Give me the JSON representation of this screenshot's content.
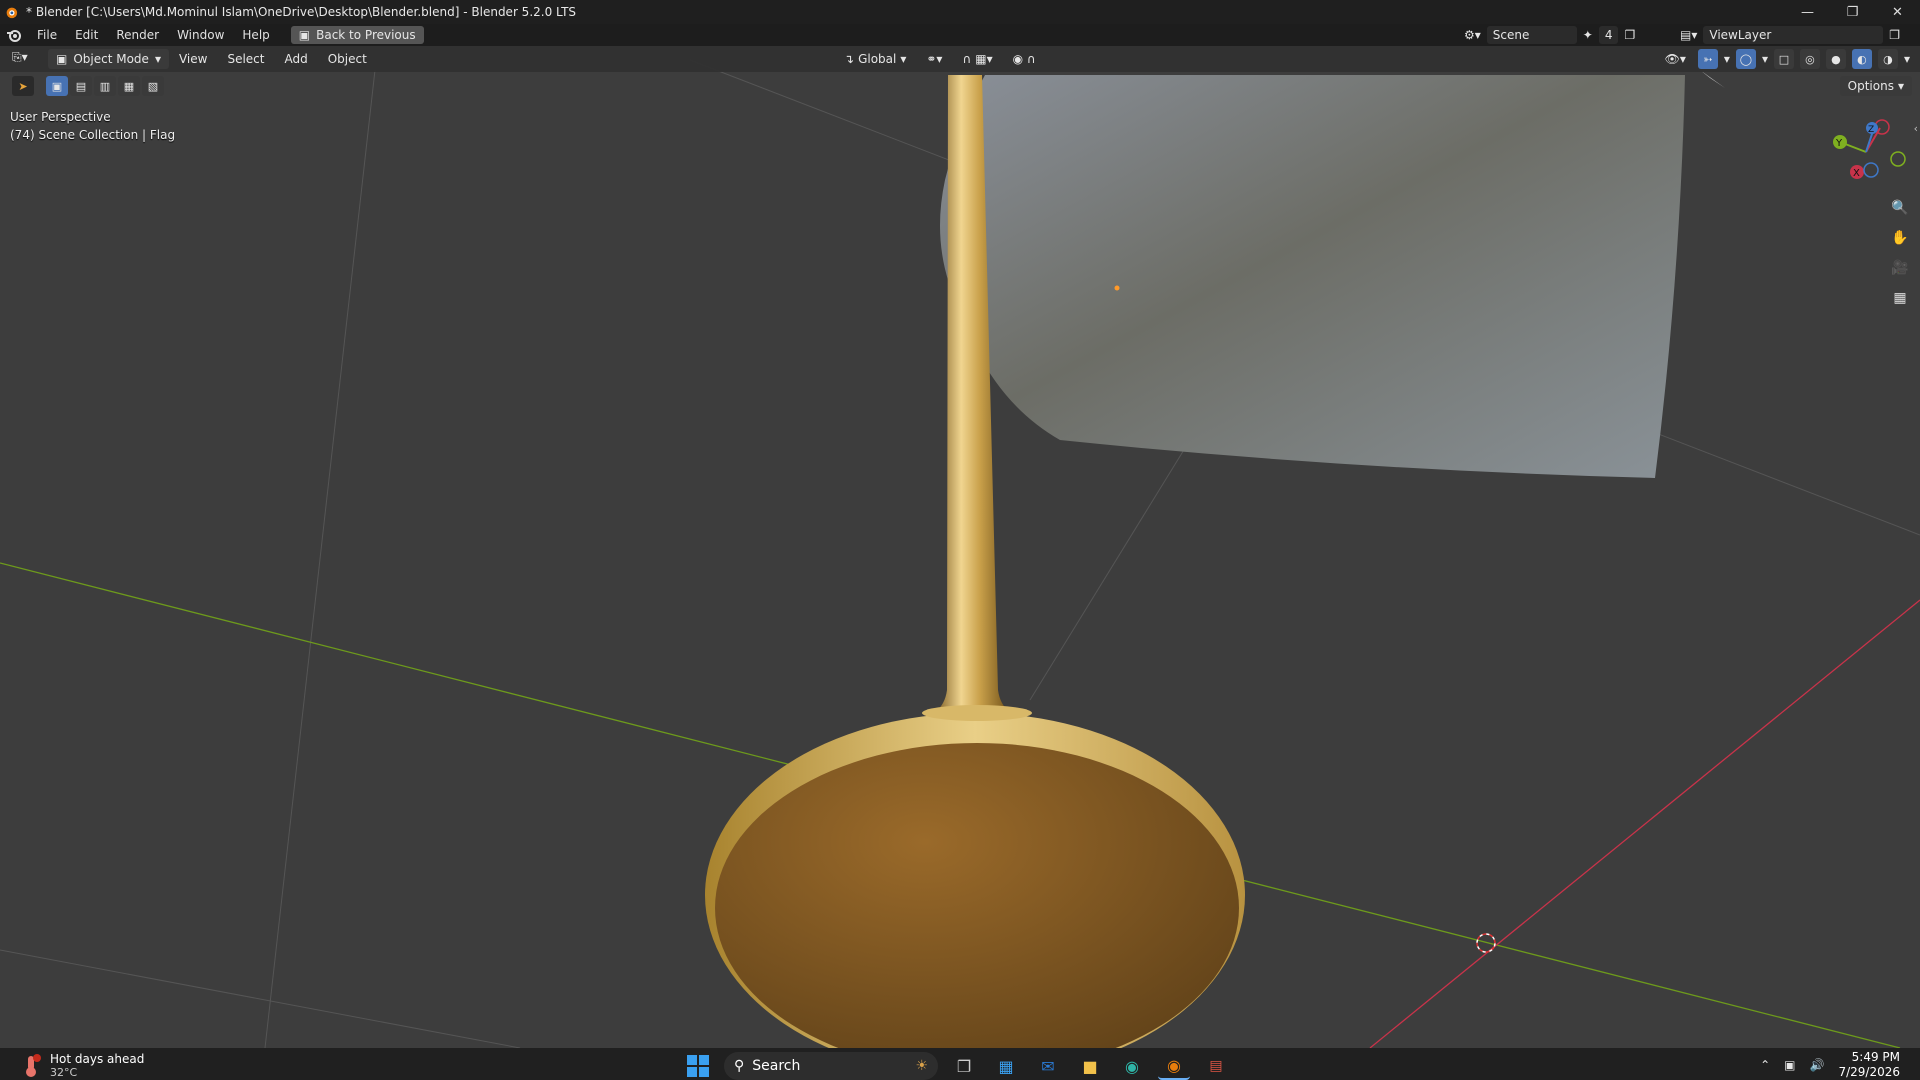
{
  "window": {
    "title": "* Blender [C:\\Users\\Md.Mominul Islam\\OneDrive\\Desktop\\Blender.blend] - Blender 5.2.0 LTS",
    "controls": [
      "minimize",
      "maximize",
      "close"
    ]
  },
  "menubar": {
    "items": [
      "File",
      "Edit",
      "Render",
      "Window",
      "Help"
    ],
    "back_button": "Back to Previous",
    "scene_label": "Scene",
    "scene_count": "4",
    "view_layer": "ViewLayer"
  },
  "viewport_header": {
    "mode": "Object Mode",
    "menus": [
      "View",
      "Select",
      "Add",
      "Object"
    ],
    "transform_orientation": "Global",
    "options_label": "Options"
  },
  "overlay": {
    "perspective": "User Perspective",
    "collection": "(74) Scene Collection | Flag"
  },
  "gizmo": {
    "axes": [
      "X",
      "Y",
      "Z"
    ]
  },
  "colors": {
    "x_axis": "#c8334a",
    "y_axis": "#7fb020",
    "z_axis": "#3f78c8",
    "active": "#4772b3",
    "gold": "#c69a3c"
  },
  "taskbar": {
    "weather_title": "Hot days ahead",
    "weather_temp": "32°C",
    "search_placeholder": "Search",
    "time": "5:49 PM",
    "date": "7/29/2026"
  }
}
